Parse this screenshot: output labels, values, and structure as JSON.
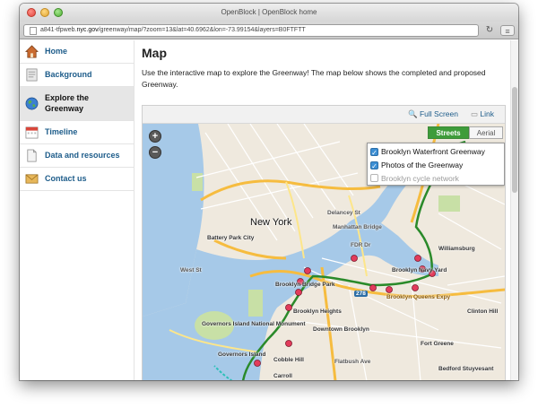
{
  "window": {
    "title": "OpenBlock | OpenBlock home",
    "url_prefix": "a841-tfpweb.",
    "url_domain": "nyc.gov",
    "url_path": "/greenway/map/?zoom=13&lat=40.6962&lon=-73.99154&layers=B0FTFTT"
  },
  "sidebar": {
    "items": [
      {
        "label": "Home",
        "icon": "house-icon"
      },
      {
        "label": "Background",
        "icon": "document-icon"
      },
      {
        "label": "Explore the Greenway",
        "icon": "globe-icon",
        "active": true
      },
      {
        "label": "Timeline",
        "icon": "calendar-icon"
      },
      {
        "label": "Data and resources",
        "icon": "file-icon"
      },
      {
        "label": "Contact us",
        "icon": "envelope-icon"
      }
    ]
  },
  "main": {
    "title": "Map",
    "intro": "Use the interactive map to explore the Greenway! The map below shows the completed and proposed Greenway."
  },
  "map": {
    "toolbar": {
      "fullscreen": "Full Screen",
      "link": "Link"
    },
    "map_types": {
      "streets": "Streets",
      "aerial": "Aerial",
      "selected": "Streets"
    },
    "zoom": {
      "in": "+",
      "out": "−"
    },
    "layers": [
      {
        "label": "Brooklyn Waterfront Greenway",
        "checked": true
      },
      {
        "label": "Photos of the Greenway",
        "checked": true
      },
      {
        "label": "Brooklyn cycle network",
        "checked": false
      }
    ],
    "labels": {
      "new_york": "New York",
      "williamsburg": "Williamsburg",
      "battery_park_city": "Battery Park City",
      "brooklyn_bridge_park": "Brooklyn Bridge Park",
      "brooklyn_heights": "Brooklyn Heights",
      "downtown_brooklyn": "Downtown Brooklyn",
      "governors_island_nm": "Governors Island National Monument",
      "governors_island": "Governors Island",
      "brooklyn_navy_yard": "Brooklyn Navy Yard",
      "brooklyn_queens_expy": "Brooklyn Queens Expy",
      "cobble_hill": "Cobble Hill",
      "carroll": "Carroll",
      "fort_greene": "Fort Greene",
      "clinton_hill": "Clinton Hill",
      "bedford_stuyvesant": "Bedford Stuyvesant",
      "west_st": "West St",
      "manhattan_bridge": "Manhattan Bridge",
      "delancey_st": "Delancey St",
      "flatbush_ave": "Flatbush Ave",
      "fdr_dr": "FDR Dr",
      "route_278": "278"
    },
    "colors": {
      "greenway": "#2a8a2a",
      "photo_marker": "#e23b5b",
      "water": "#a6c9e8",
      "park": "#c8e0a6"
    }
  }
}
